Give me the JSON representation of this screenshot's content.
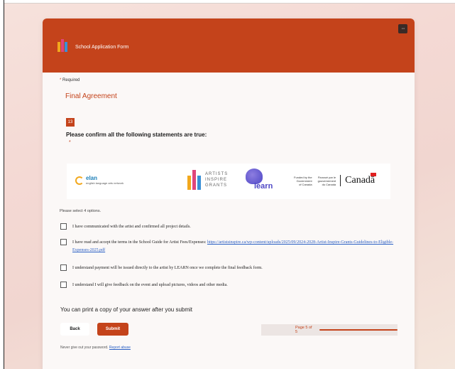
{
  "header": {
    "title": "School Application Form",
    "more_label": "···"
  },
  "required": {
    "star": "*",
    "label": "Required"
  },
  "section": {
    "title": "Final Agreement"
  },
  "question": {
    "number": "13",
    "text": "Please confirm all the following statements are true:",
    "required_star": "*"
  },
  "logos": {
    "elan_name": "elan",
    "elan_sub": "english language arts network",
    "aig_text": [
      "ARTISTS",
      "INSPIRE",
      "GRANTS"
    ],
    "learn_word": "learn",
    "gov_en": [
      "Funded by the",
      "Government",
      "of Canada"
    ],
    "gov_fr": [
      "Financé par le",
      "gouvernement",
      "du Canada"
    ],
    "canada_word": "Canadā"
  },
  "options": {
    "hint": "Please select 4 options.",
    "items": [
      {
        "label": "I have communicated with the artist and confirmed all project details."
      },
      {
        "label": "I have read and accept the terms in the School Guide for Artist Fees/Expenses: ",
        "link": "https://artistsinspire.ca/wp-content/uploads/2025/09/2024-2028-Artist-Inspire-Grants-Guidelines-to-Eligible-Expenses-2025.pdf"
      },
      {
        "label": "I understand payment will be issued directly to the artist by LEARN once we complete the final feedback form."
      },
      {
        "label": "I understand I will give feedback on the event and upload pictures, videos and other media."
      }
    ]
  },
  "print_note": "You can print a copy of your answer after you submit",
  "buttons": {
    "back": "Back",
    "submit": "Submit"
  },
  "pager": {
    "label": "Page 5 of 5",
    "progress": 1.0
  },
  "footer": {
    "text": "Never give out your password. ",
    "link": "Report abuse"
  },
  "colors": {
    "accent": "#c4431b",
    "link": "#2a5fc4"
  }
}
